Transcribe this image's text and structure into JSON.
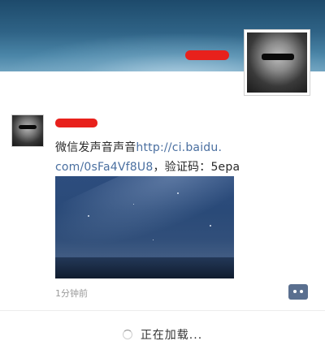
{
  "post": {
    "text_plain": "微信发声音声音",
    "link_part1": "http://ci.baidu.",
    "link_part2": "com/0sFa4Vf8U8",
    "code_label": "，验证码：",
    "code_value": "5epa",
    "time": "1分钟前"
  },
  "footer": {
    "loading": "正在加载..."
  },
  "icons": {
    "comment": "comment-bubble-icon",
    "loading": "spinner-icon"
  },
  "colors": {
    "redaction": "#e8211c",
    "link": "#4a6fa0",
    "comment_button": "#5a6f8f"
  }
}
